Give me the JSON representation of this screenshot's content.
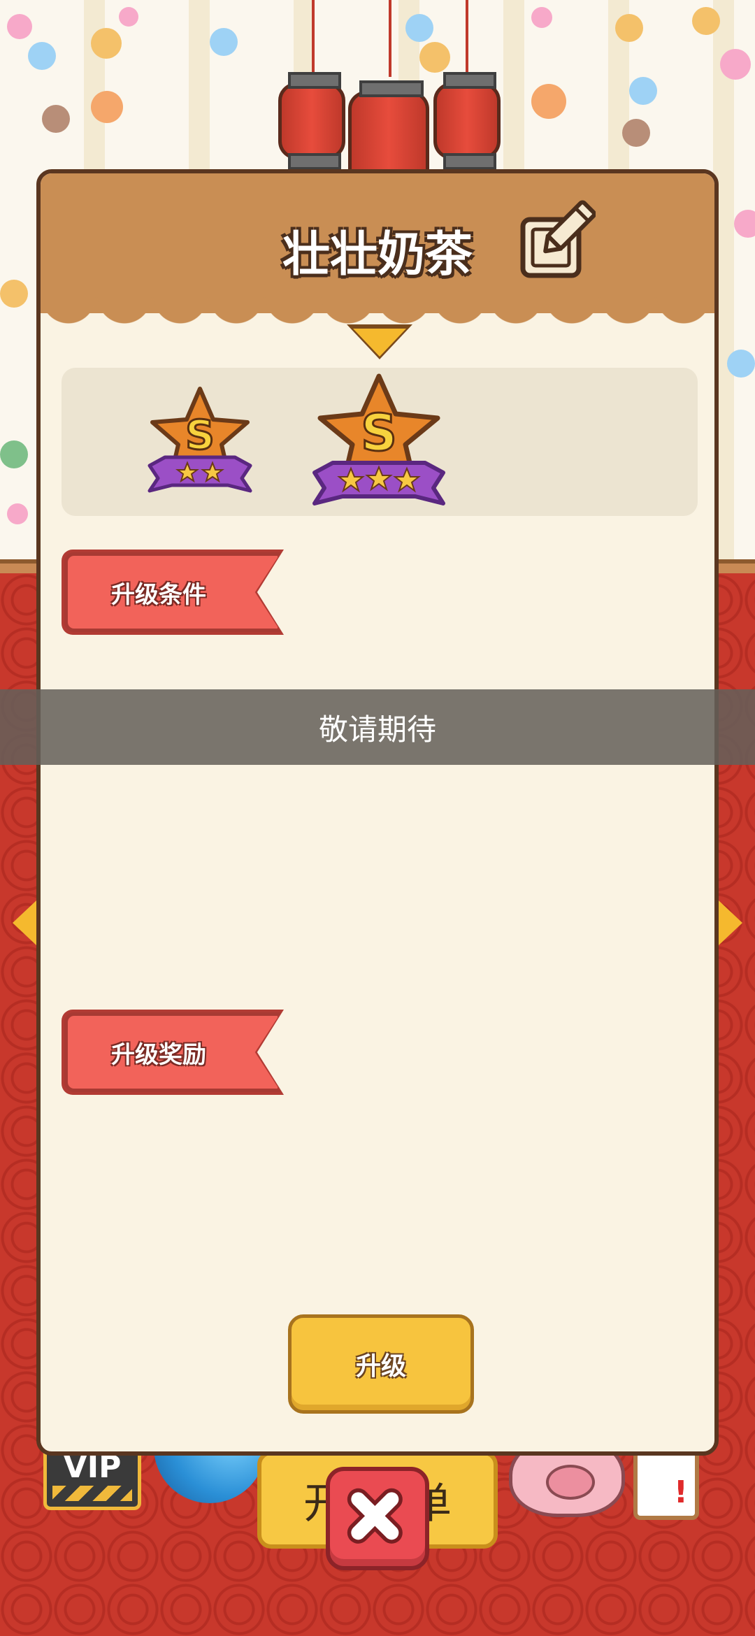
{
  "shop": {
    "name": "壮壮奶茶"
  },
  "rank": {
    "current": {
      "letter": "S",
      "stars": 2
    },
    "next": {
      "letter": "S",
      "stars": 3
    }
  },
  "sections": {
    "conditions_label": "升级条件",
    "rewards_label": "升级奖励"
  },
  "toast": {
    "message": "敬请期待"
  },
  "actions": {
    "upgrade_label": "升级"
  },
  "background": {
    "vip_label": "VIP",
    "open_order_left": "开",
    "open_order_right": "单",
    "notice_mark": "!"
  },
  "colors": {
    "header_brown": "#c98e54",
    "panel_cream": "#faf3e3",
    "ribbon_red": "#f2635a",
    "button_yellow": "#f7c43e",
    "close_red": "#ea4b52",
    "badge_orange": "#e8862a",
    "badge_purple": "#9b4fc6"
  },
  "icons": {
    "edit": "edit-pencil-icon",
    "close": "close-x-icon",
    "indicator": "triangle-down-icon",
    "rank": "s-rank-star-badge-icon"
  }
}
